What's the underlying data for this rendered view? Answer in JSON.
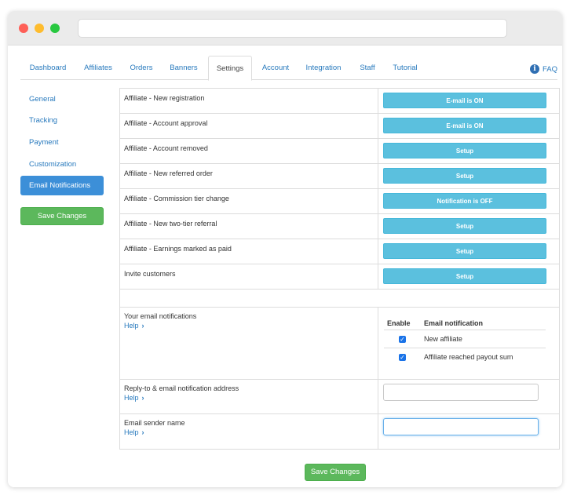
{
  "tabs": [
    "Dashboard",
    "Affiliates",
    "Orders",
    "Banners",
    "Settings",
    "Account",
    "Integration",
    "Staff",
    "Tutorial"
  ],
  "active_tab": "Settings",
  "faq": {
    "label": "FAQ",
    "icon": "info-icon"
  },
  "sidebar": {
    "items": [
      "General",
      "Tracking",
      "Payment",
      "Customization",
      "Email Notifications"
    ],
    "active": "Email Notifications",
    "save_label": "Save Changes"
  },
  "notifications": [
    {
      "label": "Affiliate - New registration",
      "button_prefix": "E-mail is",
      "button_state": "ON"
    },
    {
      "label": "Affiliate - Account approval",
      "button_prefix": "E-mail is",
      "button_state": "ON"
    },
    {
      "label": "Affiliate - Account removed",
      "button_prefix": "Setup",
      "button_state": ""
    },
    {
      "label": "Affiliate - New referred order",
      "button_prefix": "Setup",
      "button_state": ""
    },
    {
      "label": "Affiliate - Commission tier change",
      "button_prefix": "Notification is",
      "button_state": "OFF"
    },
    {
      "label": "Affiliate - New two-tier referral",
      "button_prefix": "Setup",
      "button_state": ""
    },
    {
      "label": "Affiliate - Earnings marked as paid",
      "button_prefix": "Setup",
      "button_state": ""
    },
    {
      "label": "Invite customers",
      "button_prefix": "Setup",
      "button_state": ""
    }
  ],
  "your_notifications": {
    "label": "Your email notifications",
    "help": "Help",
    "col_enable": "Enable",
    "col_notification": "Email notification",
    "items": [
      {
        "label": "New affiliate",
        "checked": true
      },
      {
        "label": "Affiliate reached payout sum",
        "checked": true
      }
    ]
  },
  "reply_to": {
    "label": "Reply-to & email notification address",
    "help": "Help",
    "value": ""
  },
  "sender_name": {
    "label": "Email sender name",
    "help": "Help",
    "value": ""
  },
  "footer": {
    "save_label": "Save Changes"
  },
  "colors": {
    "accent": "#2779bd",
    "info_button": "#5bc0de",
    "save_button": "#5cb85c",
    "active_side": "#3c8fd8"
  }
}
